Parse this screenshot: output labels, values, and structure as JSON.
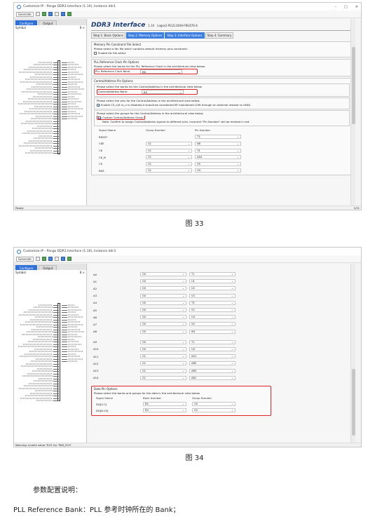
{
  "window": {
    "title": "Customize IP - Pango DDR3 Interface (1.10), Instance ddr1",
    "title2": "Customize IP - Pango DDR3 Interface (1.10), Instance ddr3"
  },
  "toolbar": {
    "generate_label": "Generate"
  },
  "left_tabs": [
    "Configure",
    "Output"
  ],
  "symbol_label": "Symbol",
  "symbol_controls": "8 ×",
  "ddr": {
    "title": "DDR3 Interface",
    "version": "1.10",
    "device": "Logos2-PG2L100H-FBG676-6"
  },
  "steps": [
    "Step 1: Basic Options",
    "Step 2: Memory Options",
    "Step 3: Interface Options",
    "Step 4: Summary"
  ],
  "memory_file": {
    "title": "Memory Pin Constraint File Select",
    "desc": "Please select a fdc file which contains default memory pins constraint.",
    "checkbox": "Enable fdc file select"
  },
  "pll": {
    "title": "PLL Reference Clock Pin Options",
    "desc": "Please select the banks for the PLL Reference Clock in the architectural view below.",
    "label": "PLL Reference Clock Bank:",
    "value": "B6"
  },
  "ctrl_addr": {
    "title": "Control/Address Pin Options",
    "desc": "Please select the banks for the Control/Address in the architectural view below.",
    "label": "Control/Address Bank:",
    "value": "B5",
    "pins_desc": "Please select the pins for the Control/Address in the architectural view below.",
    "cs_text": "Enable CS_n(if cs_n is disabled,it should be considered BF maintained LOW through an external resister to GND)",
    "groups_desc": "Please select the groups for the Control/Address in the architectural view below.",
    "custom_label": "Custom Control/Address Group",
    "note": "Note: Confirm to assign Control/Address signals to different pins. Incorrect \"Pin Number\" will be marked in red."
  },
  "table_headers": [
    "Signal Name",
    "Group Number",
    "Pin Number"
  ],
  "table1_rows": [
    {
      "signal": "RESET",
      "group": "",
      "pin": "T3"
    },
    {
      "signal": "CKE",
      "group": "G1",
      "pin": "N8"
    },
    {
      "signal": "CK",
      "group": "G1",
      "pin": "T4"
    },
    {
      "signal": "CK_N",
      "group": "G1",
      "pin": "AA4"
    },
    {
      "signal": "CS",
      "group": "G1",
      "pin": "U5"
    },
    {
      "signal": "RAS",
      "group": "G1",
      "pin": "U4"
    }
  ],
  "table2_rows": [
    {
      "signal": "A0",
      "group": "G0",
      "pin": "T1"
    },
    {
      "signal": "A1",
      "group": "G0",
      "pin": "U1"
    },
    {
      "signal": "A2",
      "group": "G0",
      "pin": "U2"
    },
    {
      "signal": "A3",
      "group": "G0",
      "pin": "V3"
    },
    {
      "signal": "A4",
      "group": "G0",
      "pin": "T3"
    },
    {
      "signal": "A5",
      "group": "G0",
      "pin": "V2"
    },
    {
      "signal": "A6",
      "group": "G0",
      "pin": "U4"
    },
    {
      "signal": "A7",
      "group": "G0",
      "pin": "V4"
    },
    {
      "signal": "A8",
      "group": "G0",
      "pin": "W1"
    },
    {
      "signal": "A9",
      "group": "G0",
      "pin": "T1"
    },
    {
      "signal": "A10",
      "group": "G0",
      "pin": "U3"
    },
    {
      "signal": "A11",
      "group": "G1",
      "pin": "AA1"
    },
    {
      "signal": "A12",
      "group": "G1",
      "pin": "AB5"
    },
    {
      "signal": "A13",
      "group": "G1",
      "pin": "AB3"
    },
    {
      "signal": "A14",
      "group": "G1",
      "pin": "AB1"
    }
  ],
  "data_pins": {
    "title": "Data Pin Options",
    "desc": "Please select the banks and groups for the data in the architectural view below.",
    "headers": [
      "Signal Name",
      "Bank Number",
      "Group Number"
    ],
    "rows": [
      {
        "signal": "DQ[0:7]",
        "bank": "B4",
        "group": "G0"
      },
      {
        "signal": "DQ[8:15]",
        "bank": "B4",
        "group": "G2"
      }
    ]
  },
  "status": {
    "ready": "Ready",
    "size": "1/31",
    "warning": "Warning: invalid value 'R19' for 'PAD_R19'"
  },
  "captions": [
    "图 33",
    "图 34"
  ],
  "paragraphs": [
    "参数配置说明：",
    "PLL Reference Bank：PLL 参考时钟所在的 Bank；"
  ],
  "colors": {
    "accent": "#2e6fd8",
    "highlight": "#e02424"
  }
}
